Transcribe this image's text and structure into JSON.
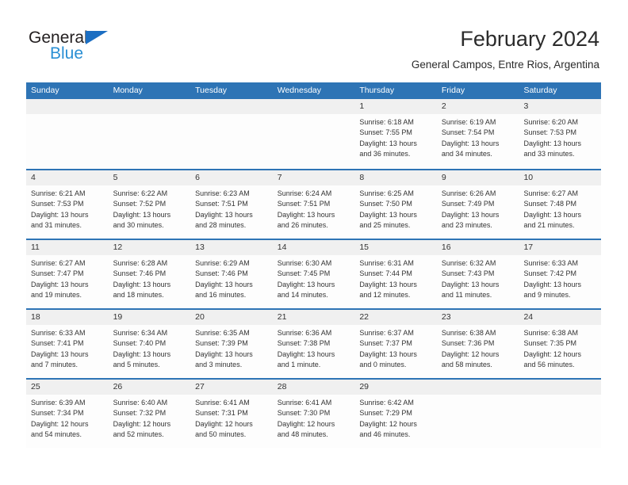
{
  "brand": {
    "name_dark": "General",
    "name_blue": "Blue",
    "accent_blue": "#2e74b5",
    "logo_blue": "#2a8fd4"
  },
  "header": {
    "title": "February 2024",
    "subtitle": "General Campos, Entre Rios, Argentina"
  },
  "calendar": {
    "weekday_headers": [
      "Sunday",
      "Monday",
      "Tuesday",
      "Wednesday",
      "Thursday",
      "Friday",
      "Saturday"
    ],
    "weeks": [
      [
        {
          "day": "",
          "lines": []
        },
        {
          "day": "",
          "lines": []
        },
        {
          "day": "",
          "lines": []
        },
        {
          "day": "",
          "lines": []
        },
        {
          "day": "1",
          "lines": [
            "Sunrise: 6:18 AM",
            "Sunset: 7:55 PM",
            "Daylight: 13 hours",
            "and 36 minutes."
          ]
        },
        {
          "day": "2",
          "lines": [
            "Sunrise: 6:19 AM",
            "Sunset: 7:54 PM",
            "Daylight: 13 hours",
            "and 34 minutes."
          ]
        },
        {
          "day": "3",
          "lines": [
            "Sunrise: 6:20 AM",
            "Sunset: 7:53 PM",
            "Daylight: 13 hours",
            "and 33 minutes."
          ]
        }
      ],
      [
        {
          "day": "4",
          "lines": [
            "Sunrise: 6:21 AM",
            "Sunset: 7:53 PM",
            "Daylight: 13 hours",
            "and 31 minutes."
          ]
        },
        {
          "day": "5",
          "lines": [
            "Sunrise: 6:22 AM",
            "Sunset: 7:52 PM",
            "Daylight: 13 hours",
            "and 30 minutes."
          ]
        },
        {
          "day": "6",
          "lines": [
            "Sunrise: 6:23 AM",
            "Sunset: 7:51 PM",
            "Daylight: 13 hours",
            "and 28 minutes."
          ]
        },
        {
          "day": "7",
          "lines": [
            "Sunrise: 6:24 AM",
            "Sunset: 7:51 PM",
            "Daylight: 13 hours",
            "and 26 minutes."
          ]
        },
        {
          "day": "8",
          "lines": [
            "Sunrise: 6:25 AM",
            "Sunset: 7:50 PM",
            "Daylight: 13 hours",
            "and 25 minutes."
          ]
        },
        {
          "day": "9",
          "lines": [
            "Sunrise: 6:26 AM",
            "Sunset: 7:49 PM",
            "Daylight: 13 hours",
            "and 23 minutes."
          ]
        },
        {
          "day": "10",
          "lines": [
            "Sunrise: 6:27 AM",
            "Sunset: 7:48 PM",
            "Daylight: 13 hours",
            "and 21 minutes."
          ]
        }
      ],
      [
        {
          "day": "11",
          "lines": [
            "Sunrise: 6:27 AM",
            "Sunset: 7:47 PM",
            "Daylight: 13 hours",
            "and 19 minutes."
          ]
        },
        {
          "day": "12",
          "lines": [
            "Sunrise: 6:28 AM",
            "Sunset: 7:46 PM",
            "Daylight: 13 hours",
            "and 18 minutes."
          ]
        },
        {
          "day": "13",
          "lines": [
            "Sunrise: 6:29 AM",
            "Sunset: 7:46 PM",
            "Daylight: 13 hours",
            "and 16 minutes."
          ]
        },
        {
          "day": "14",
          "lines": [
            "Sunrise: 6:30 AM",
            "Sunset: 7:45 PM",
            "Daylight: 13 hours",
            "and 14 minutes."
          ]
        },
        {
          "day": "15",
          "lines": [
            "Sunrise: 6:31 AM",
            "Sunset: 7:44 PM",
            "Daylight: 13 hours",
            "and 12 minutes."
          ]
        },
        {
          "day": "16",
          "lines": [
            "Sunrise: 6:32 AM",
            "Sunset: 7:43 PM",
            "Daylight: 13 hours",
            "and 11 minutes."
          ]
        },
        {
          "day": "17",
          "lines": [
            "Sunrise: 6:33 AM",
            "Sunset: 7:42 PM",
            "Daylight: 13 hours",
            "and 9 minutes."
          ]
        }
      ],
      [
        {
          "day": "18",
          "lines": [
            "Sunrise: 6:33 AM",
            "Sunset: 7:41 PM",
            "Daylight: 13 hours",
            "and 7 minutes."
          ]
        },
        {
          "day": "19",
          "lines": [
            "Sunrise: 6:34 AM",
            "Sunset: 7:40 PM",
            "Daylight: 13 hours",
            "and 5 minutes."
          ]
        },
        {
          "day": "20",
          "lines": [
            "Sunrise: 6:35 AM",
            "Sunset: 7:39 PM",
            "Daylight: 13 hours",
            "and 3 minutes."
          ]
        },
        {
          "day": "21",
          "lines": [
            "Sunrise: 6:36 AM",
            "Sunset: 7:38 PM",
            "Daylight: 13 hours",
            "and 1 minute."
          ]
        },
        {
          "day": "22",
          "lines": [
            "Sunrise: 6:37 AM",
            "Sunset: 7:37 PM",
            "Daylight: 13 hours",
            "and 0 minutes."
          ]
        },
        {
          "day": "23",
          "lines": [
            "Sunrise: 6:38 AM",
            "Sunset: 7:36 PM",
            "Daylight: 12 hours",
            "and 58 minutes."
          ]
        },
        {
          "day": "24",
          "lines": [
            "Sunrise: 6:38 AM",
            "Sunset: 7:35 PM",
            "Daylight: 12 hours",
            "and 56 minutes."
          ]
        }
      ],
      [
        {
          "day": "25",
          "lines": [
            "Sunrise: 6:39 AM",
            "Sunset: 7:34 PM",
            "Daylight: 12 hours",
            "and 54 minutes."
          ]
        },
        {
          "day": "26",
          "lines": [
            "Sunrise: 6:40 AM",
            "Sunset: 7:32 PM",
            "Daylight: 12 hours",
            "and 52 minutes."
          ]
        },
        {
          "day": "27",
          "lines": [
            "Sunrise: 6:41 AM",
            "Sunset: 7:31 PM",
            "Daylight: 12 hours",
            "and 50 minutes."
          ]
        },
        {
          "day": "28",
          "lines": [
            "Sunrise: 6:41 AM",
            "Sunset: 7:30 PM",
            "Daylight: 12 hours",
            "and 48 minutes."
          ]
        },
        {
          "day": "29",
          "lines": [
            "Sunrise: 6:42 AM",
            "Sunset: 7:29 PM",
            "Daylight: 12 hours",
            "and 46 minutes."
          ]
        },
        {
          "day": "",
          "lines": []
        },
        {
          "day": "",
          "lines": []
        }
      ]
    ]
  }
}
